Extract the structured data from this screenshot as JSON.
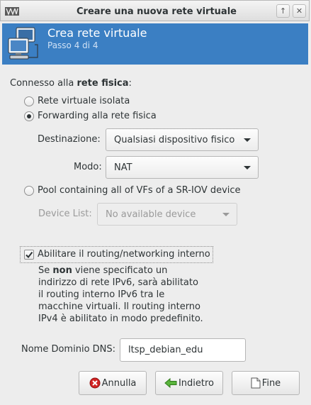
{
  "window": {
    "title": "Creare una nuova rete virtuale",
    "up_glyph": "↑",
    "close_glyph": "✕"
  },
  "header": {
    "title": "Crea rete virtuale",
    "subtitle": "Passo 4 di 4",
    "bg_color": "#3b7fc3",
    "icon": "network-computers-icon"
  },
  "connection": {
    "label_prefix": "Connesso alla ",
    "label_bold": "rete fisica",
    "label_suffix": ":",
    "options": [
      {
        "label": "Rete virtuale isolata",
        "selected": false
      },
      {
        "label": "Forwarding alla rete fisica",
        "selected": true
      },
      {
        "label": "Pool containing all of VFs of a SR-IOV device",
        "selected": false
      }
    ],
    "destination_label": "Destinazione:",
    "destination_value": "Qualsiasi dispositivo fisico",
    "mode_label": "Modo:",
    "mode_value": "NAT",
    "device_list_label": "Device List:",
    "device_list_value": "No available device"
  },
  "routing": {
    "checkbox_label": "Abilitare il routing/networking interno",
    "checked": true,
    "info_line1_pre": "Se ",
    "info_line1_bold": "non",
    "info_line1_post": " viene specificato un",
    "info_line2": "indirizzo di rete IPv6, sarà abilitato",
    "info_line3": "il routing interno IPv6 tra le",
    "info_line4": "macchine virtuali. Il routing interno",
    "info_line5": "IPv4 è abilitato in modo predefinito."
  },
  "dns": {
    "label": "Nome Dominio DNS:",
    "value": "ltsp_debian_edu"
  },
  "buttons": {
    "cancel": "Annulla",
    "back": "Indietro",
    "finish": "Fine"
  }
}
